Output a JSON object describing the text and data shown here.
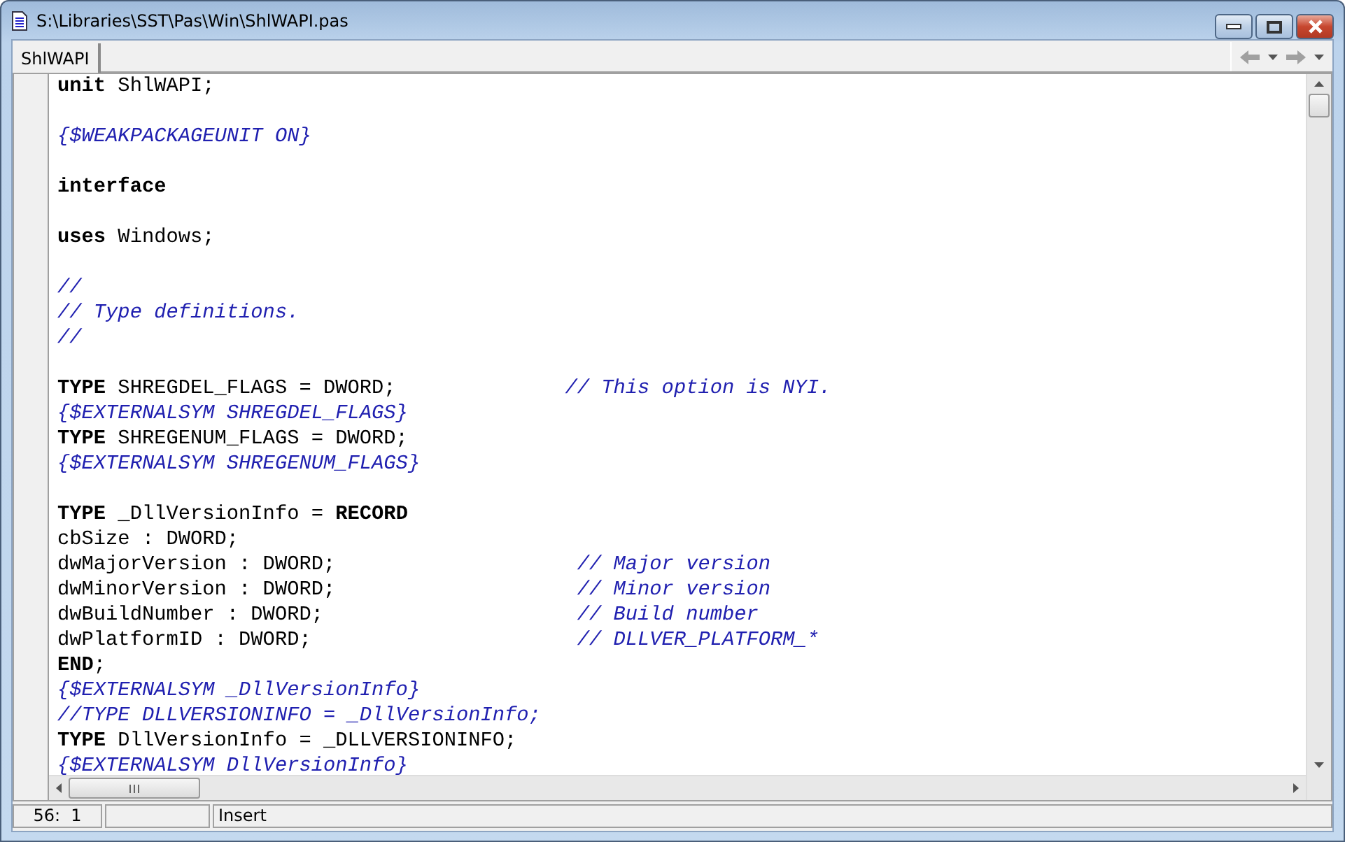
{
  "window": {
    "title": "S:\\Libraries\\SST\\Pas\\Win\\ShlWAPI.pas"
  },
  "tabs": [
    {
      "label": "ShlWAPI",
      "selected": true
    }
  ],
  "code_lines": [
    {
      "kind": "code",
      "tokens": [
        {
          "kind": "keyword",
          "text": "unit"
        },
        {
          "kind": "plain",
          "text": " ShlWAPI;"
        }
      ]
    },
    {
      "kind": "blank"
    },
    {
      "kind": "code",
      "tokens": [
        {
          "kind": "comment",
          "text": "{$WEAKPACKAGEUNIT ON}"
        }
      ]
    },
    {
      "kind": "blank"
    },
    {
      "kind": "code",
      "tokens": [
        {
          "kind": "keyword",
          "text": "interface"
        }
      ]
    },
    {
      "kind": "blank"
    },
    {
      "kind": "code",
      "tokens": [
        {
          "kind": "keyword",
          "text": "uses"
        },
        {
          "kind": "plain",
          "text": " Windows;"
        }
      ]
    },
    {
      "kind": "blank"
    },
    {
      "kind": "code",
      "tokens": [
        {
          "kind": "comment",
          "text": "//"
        }
      ]
    },
    {
      "kind": "code",
      "tokens": [
        {
          "kind": "comment",
          "text": "// Type definitions."
        }
      ]
    },
    {
      "kind": "code",
      "tokens": [
        {
          "kind": "comment",
          "text": "//"
        }
      ]
    },
    {
      "kind": "blank"
    },
    {
      "kind": "code",
      "tokens": [
        {
          "kind": "keyword",
          "text": "TYPE"
        },
        {
          "kind": "plain",
          "text": " SHREGDEL_FLAGS = DWORD;              "
        },
        {
          "kind": "comment",
          "text": "// This option is NYI."
        }
      ]
    },
    {
      "kind": "code",
      "tokens": [
        {
          "kind": "comment",
          "text": "{$EXTERNALSYM SHREGDEL_FLAGS}"
        }
      ]
    },
    {
      "kind": "code",
      "tokens": [
        {
          "kind": "keyword",
          "text": "TYPE"
        },
        {
          "kind": "plain",
          "text": " SHREGENUM_FLAGS = DWORD;"
        }
      ]
    },
    {
      "kind": "code",
      "tokens": [
        {
          "kind": "comment",
          "text": "{$EXTERNALSYM SHREGENUM_FLAGS}"
        }
      ]
    },
    {
      "kind": "blank"
    },
    {
      "kind": "code",
      "tokens": [
        {
          "kind": "keyword",
          "text": "TYPE"
        },
        {
          "kind": "plain",
          "text": " _DllVersionInfo = "
        },
        {
          "kind": "keyword",
          "text": "RECORD"
        }
      ]
    },
    {
      "kind": "code",
      "tokens": [
        {
          "kind": "plain",
          "text": "cbSize : DWORD;"
        }
      ]
    },
    {
      "kind": "code",
      "tokens": [
        {
          "kind": "plain",
          "text": "dwMajorVersion : DWORD;                    "
        },
        {
          "kind": "comment",
          "text": "// Major version"
        }
      ]
    },
    {
      "kind": "code",
      "tokens": [
        {
          "kind": "plain",
          "text": "dwMinorVersion : DWORD;                    "
        },
        {
          "kind": "comment",
          "text": "// Minor version"
        }
      ]
    },
    {
      "kind": "code",
      "tokens": [
        {
          "kind": "plain",
          "text": "dwBuildNumber : DWORD;                     "
        },
        {
          "kind": "comment",
          "text": "// Build number"
        }
      ]
    },
    {
      "kind": "code",
      "tokens": [
        {
          "kind": "plain",
          "text": "dwPlatformID : DWORD;                      "
        },
        {
          "kind": "comment",
          "text": "// DLLVER_PLATFORM_*"
        }
      ]
    },
    {
      "kind": "code",
      "tokens": [
        {
          "kind": "keyword",
          "text": "END"
        },
        {
          "kind": "plain",
          "text": ";"
        }
      ]
    },
    {
      "kind": "code",
      "tokens": [
        {
          "kind": "comment",
          "text": "{$EXTERNALSYM _DllVersionInfo}"
        }
      ]
    },
    {
      "kind": "code",
      "tokens": [
        {
          "kind": "comment",
          "text": "//TYPE DLLVERSIONINFO = _DllVersionInfo;"
        }
      ]
    },
    {
      "kind": "code",
      "tokens": [
        {
          "kind": "keyword",
          "text": "TYPE"
        },
        {
          "kind": "plain",
          "text": " DllVersionInfo = _DLLVERSIONINFO;"
        }
      ]
    },
    {
      "kind": "code",
      "tokens": [
        {
          "kind": "comment",
          "text": "{$EXTERNALSYM DllVersionInfo}"
        }
      ]
    }
  ],
  "status_bar": {
    "position": "56:  1",
    "mode": "Insert"
  }
}
